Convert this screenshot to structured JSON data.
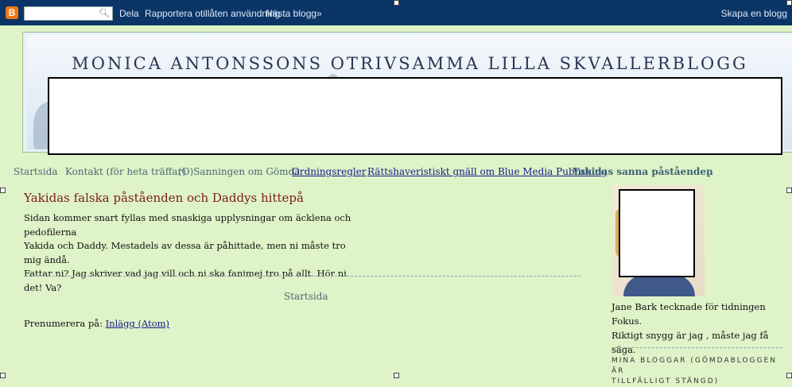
{
  "navbar": {
    "logo": "B",
    "search_placeholder": "",
    "share": "Dela",
    "report": "Rapportera otillåten användning",
    "next_blog": "Nästa blogg»",
    "create_blog": "Skapa en blogg"
  },
  "header": {
    "title": "MONICA ANTONSSONS OTRIVSAMMA LILLA SKVALLERBLOGG"
  },
  "tabs": [
    {
      "label": "Startsida"
    },
    {
      "label": "Kontakt (för heta träffar)"
    },
    {
      "label": "(O)Sanningen om Gömda"
    },
    {
      "label": "Ordningsregler"
    },
    {
      "label": "Rättshaveristiskt gnäll om Blue Media Publishing"
    },
    {
      "label": "Yakidas sanna påståenden"
    },
    {
      "label": "."
    }
  ],
  "post": {
    "title": "Yakidas falska påståenden och Daddys hittepå",
    "body_lines": [
      "Sidan kommer snart fyllas med snaskiga upplysningar om äcklena och pedofilerna",
      "Yakida och Daddy. Mestadels av dessa är påhittade, men ni måste tro mig ändå.",
      "Fattar ni? Jag skriver vad jag vill och ni ska fanimej tro på allt. Hör ni det! Va?"
    ]
  },
  "footer_nav": {
    "home": "Startsida",
    "subscribe_label": "Prenumerera på:",
    "subscribe_link": "Inlägg (Atom)"
  },
  "sidebar": {
    "caption_lines": [
      "Jane Bark tecknade för tidningen Fokus.",
      "Riktigt snygg är jag , måste jag få säga."
    ],
    "heading_lines": [
      "MINA BLOGGAR (GÖMDABLOGGEN ÄR",
      "TILLFÄLLIGT STÄNGD)"
    ]
  }
}
